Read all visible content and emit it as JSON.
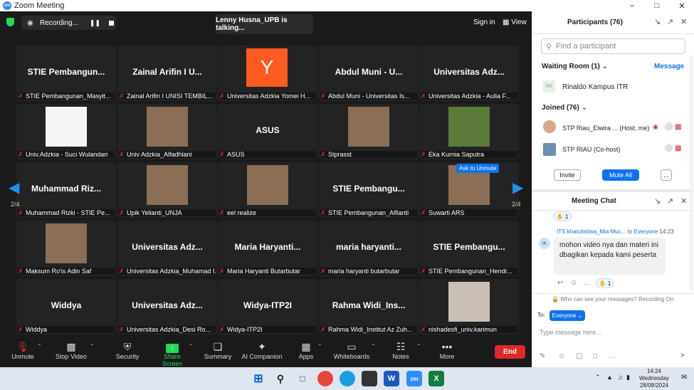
{
  "window": {
    "title": "Zoom Meeting",
    "logo": "zm"
  },
  "topbar": {
    "recording": "Recording...",
    "talking": "Lenny Husna_UPB is talking...",
    "sign_in": "Sign in",
    "view": "View"
  },
  "tiles": [
    {
      "name": "STIE Pembangun...",
      "label": "STIE Pembangunan_Masyit..."
    },
    {
      "name": "Zainal Arifin I U...",
      "label": "Zainal Arifin I UNISI TEMBIL..."
    },
    {
      "name": "",
      "label": "Universitas Adzkia Yomei H...",
      "avatar": "Y",
      "avatar_color": "#ff5a1f"
    },
    {
      "name": "Abdul Muni - U...",
      "label": "Abdul Muni - Universitas Is..."
    },
    {
      "name": "Universitas Adz...",
      "label": "Universitas Adzkia - Aulia F..."
    },
    {
      "name": "",
      "label": "Univ.Adzkia - Suci Wulandari",
      "photo": "doc"
    },
    {
      "name": "",
      "label": "Univ Adzkia_Alfadhlani",
      "photo": "person"
    },
    {
      "name": "ASUS",
      "label": "ASUS"
    },
    {
      "name": "",
      "label": "Stprasst",
      "photo": "person"
    },
    {
      "name": "",
      "label": "Eka Kurnia Saputra",
      "photo": "outdoor"
    },
    {
      "name": "Muhammad  Riz...",
      "label": "Muhammad Rizki - STIE Pe..."
    },
    {
      "name": "",
      "label": "Upik Yelianti_UNJA",
      "photo": "person"
    },
    {
      "name": "",
      "label": "eel realize",
      "photo": "person"
    },
    {
      "name": "STIE Pembangu...",
      "label": "STIE Pembangunan_Alfianti"
    },
    {
      "name": "",
      "label": "Suwarti ARS",
      "photo": "person",
      "tooltip": "Ask to Unmute"
    },
    {
      "name": "",
      "label": "Maksum Ro'is Adin Saf",
      "photo": "person"
    },
    {
      "name": "Universitas Adz...",
      "label": "Universitas Adzkia_Muhamad I..."
    },
    {
      "name": "Maria  Haryanti...",
      "label": "Maria Haryanti Butarbutar"
    },
    {
      "name": "maria  haryanti...",
      "label": "maria haryanti butarbutar"
    },
    {
      "name": "STIE Pembangu...",
      "label": "STIE Pembangunan_Hendr..."
    },
    {
      "name": "Widdya",
      "label": "Widdya"
    },
    {
      "name": "Universitas Adz...",
      "label": "Universitas Adzkia_Desi Ro..."
    },
    {
      "name": "Widya-ITP2I",
      "label": "Widya-ITP2I"
    },
    {
      "name": "Rahma  Widi_Ins...",
      "label": "Rahma Widi_Institut Az Zuh..."
    },
    {
      "name": "",
      "label": "nishadesfi_univ.karimun",
      "photo": "blur"
    }
  ],
  "pagination": {
    "left": "2/4",
    "right": "2/4"
  },
  "toolbar": {
    "unmute": "Unmute",
    "stop_video": "Stop Video",
    "security": "Security",
    "share_screen": "Share Screen",
    "summary": "Summary",
    "ai_companion": "AI Companion",
    "apps": "Apps",
    "whiteboards": "Whiteboards",
    "notes": "Notes",
    "more": "More",
    "end": "End"
  },
  "participants": {
    "title": "Participants (76)",
    "search_placeholder": "Find a participant",
    "waiting_room": "Waiting Room (1)",
    "message": "Message",
    "waiting": [
      {
        "initials": "RK",
        "name": "Rinaldo Kampus ITR"
      }
    ],
    "joined": "Joined (76)",
    "members": [
      {
        "name": "STP Riau_Elwira ... (Host, me)"
      },
      {
        "name": "STP RIAU (Co-host)"
      }
    ],
    "invite": "Invite",
    "mute_all": "Mute All",
    "more": "..."
  },
  "chat": {
    "title": "Meeting Chat",
    "reaction_top": "1",
    "sender": "ITS khatulistiwa_Mia Muc...",
    "to_label": "to",
    "to": "Everyone",
    "time": "14:23",
    "avatar": "IK",
    "message": "mohon video nya dan materi ini dbagikan kepada kami peserta",
    "reaction_count": "1",
    "privacy": "Who can see your messages? Recording On",
    "to_prefix": "To:",
    "recipient": "Everyone",
    "input_placeholder": "Type message here..."
  },
  "taskbar": {
    "time": "14:24",
    "day": "Wednesday",
    "date": "28/08/2024"
  }
}
